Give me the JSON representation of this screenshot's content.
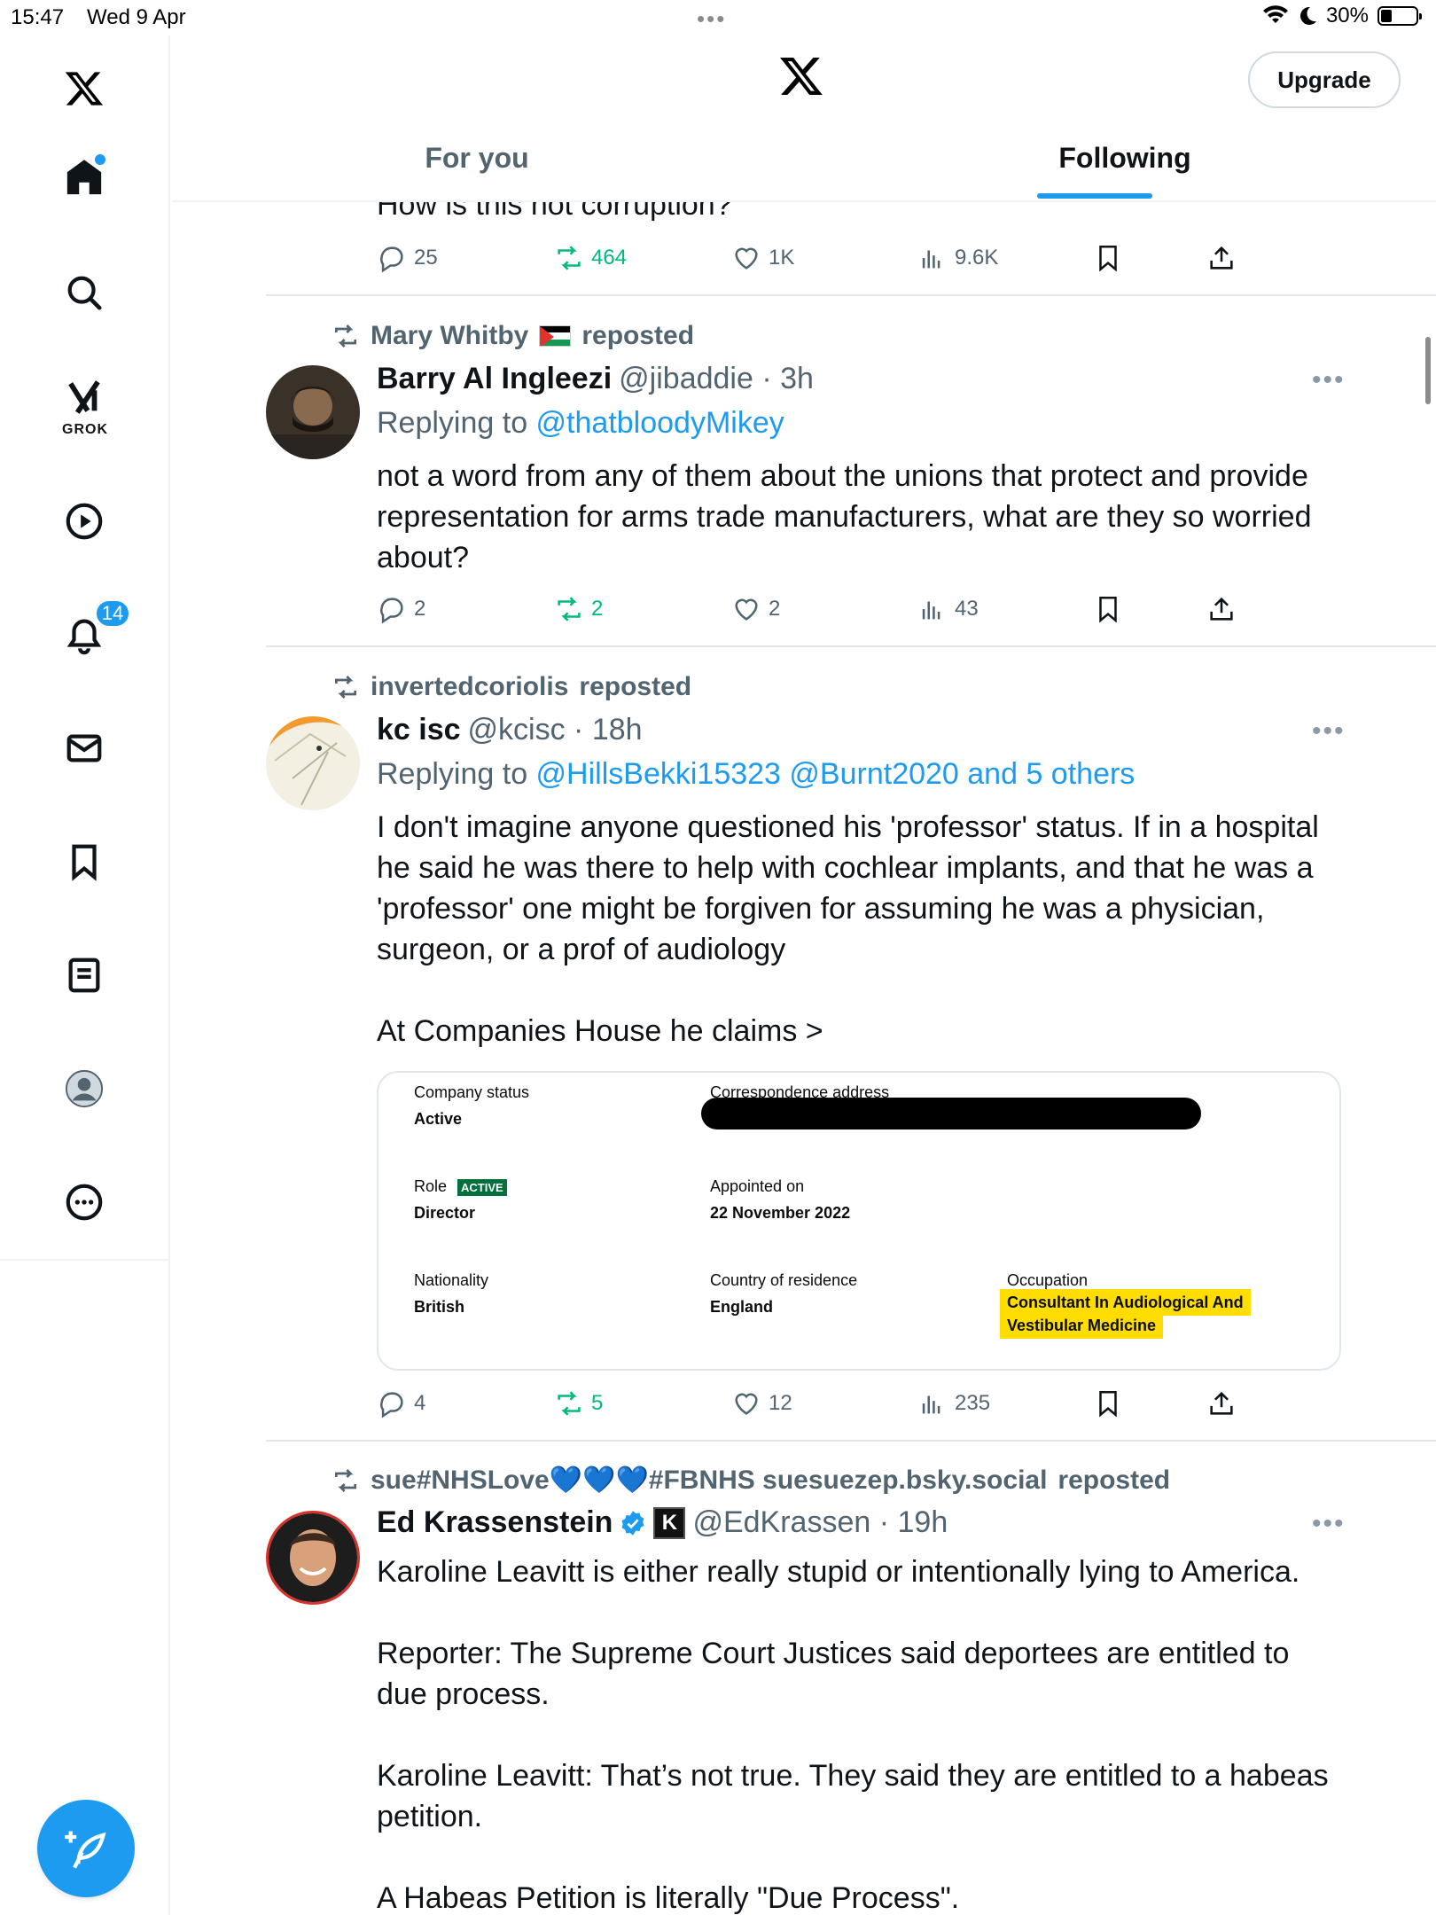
{
  "status_bar": {
    "time": "15:47",
    "date": "Wed 9 Apr",
    "dots": "•••",
    "battery": "30%"
  },
  "sidebar": {
    "grok_label": "GROK",
    "notifications_badge": "14",
    "items": [
      "home",
      "search",
      "grok",
      "videos",
      "notifications",
      "messages",
      "bookmarks",
      "lists",
      "profile",
      "more"
    ]
  },
  "header": {
    "upgrade_label": "Upgrade",
    "tabs": [
      "For you",
      "Following"
    ],
    "active_tab": "Following"
  },
  "partial_post": {
    "text": "How is this not corruption?",
    "replies": "25",
    "reposts": "464",
    "likes": "1K",
    "views": "9.6K"
  },
  "posts": [
    {
      "reposted_by": "Mary Whitby",
      "reposted_suffix": "reposted",
      "name": "Barry Al Ingleezi",
      "handle": "@jibaddie · 3h",
      "replying_prefix": "Replying to ",
      "replying_to": "@thatbloodyMikey",
      "text": "not a word from any of them about the unions that protect and provide representation for arms trade manufacturers, what are they so worried about?",
      "replies": "2",
      "reposts": "2",
      "likes": "2",
      "views": "43"
    },
    {
      "reposted_by": "invertedcoriolis",
      "reposted_suffix": "reposted",
      "name": "kc isc",
      "handle": "@kcisc · 18h",
      "replying_prefix": "Replying to ",
      "replying_to": "@HillsBekki15323 @Burnt2020 and 5 others",
      "text": "I don't imagine anyone questioned his 'professor' status. If in a hospital he said he was there to help with cochlear implants,  and that he was a 'professor'  one might be forgiven for assuming he was a physician, surgeon, or a prof of audiology\n\nAt Companies House he claims >",
      "card": {
        "company_status_label": "Company status",
        "company_status": "Active",
        "correspondence_label": "Correspondence address",
        "role_label": "Role",
        "role_tag": "ACTIVE",
        "role": "Director",
        "appointed_label": "Appointed on",
        "appointed": "22 November 2022",
        "nationality_label": "Nationality",
        "nationality": "British",
        "country_label": "Country of residence",
        "country": "England",
        "occupation_label": "Occupation",
        "occupation_line1": "Consultant In Audiological And",
        "occupation_line2": "Vestibular Medicine"
      },
      "replies": "4",
      "reposts": "5",
      "likes": "12",
      "views": "235"
    },
    {
      "reposted_by": "sue#NHSLove💙💙💙#FBNHS suesuezep.bsky.social",
      "reposted_suffix": "reposted",
      "name": "Ed Krassenstein",
      "kbadge": "K",
      "handle": "@EdKrassen · 19h",
      "text": "Karoline Leavitt is either really stupid or intentionally lying to America.\n\nReporter: The Supreme Court Justices said deportees are entitled to due process.\n\nKaroline Leavitt: That’s not true. They said they are entitled to a habeas petition.\n\nA Habeas Petition is literally \"Due Process\"."
    }
  ],
  "colors": {
    "accent": "#1d9bf0",
    "repost_green": "#00ba7c",
    "muted": "#536471",
    "highlight": "#ffdd00"
  }
}
